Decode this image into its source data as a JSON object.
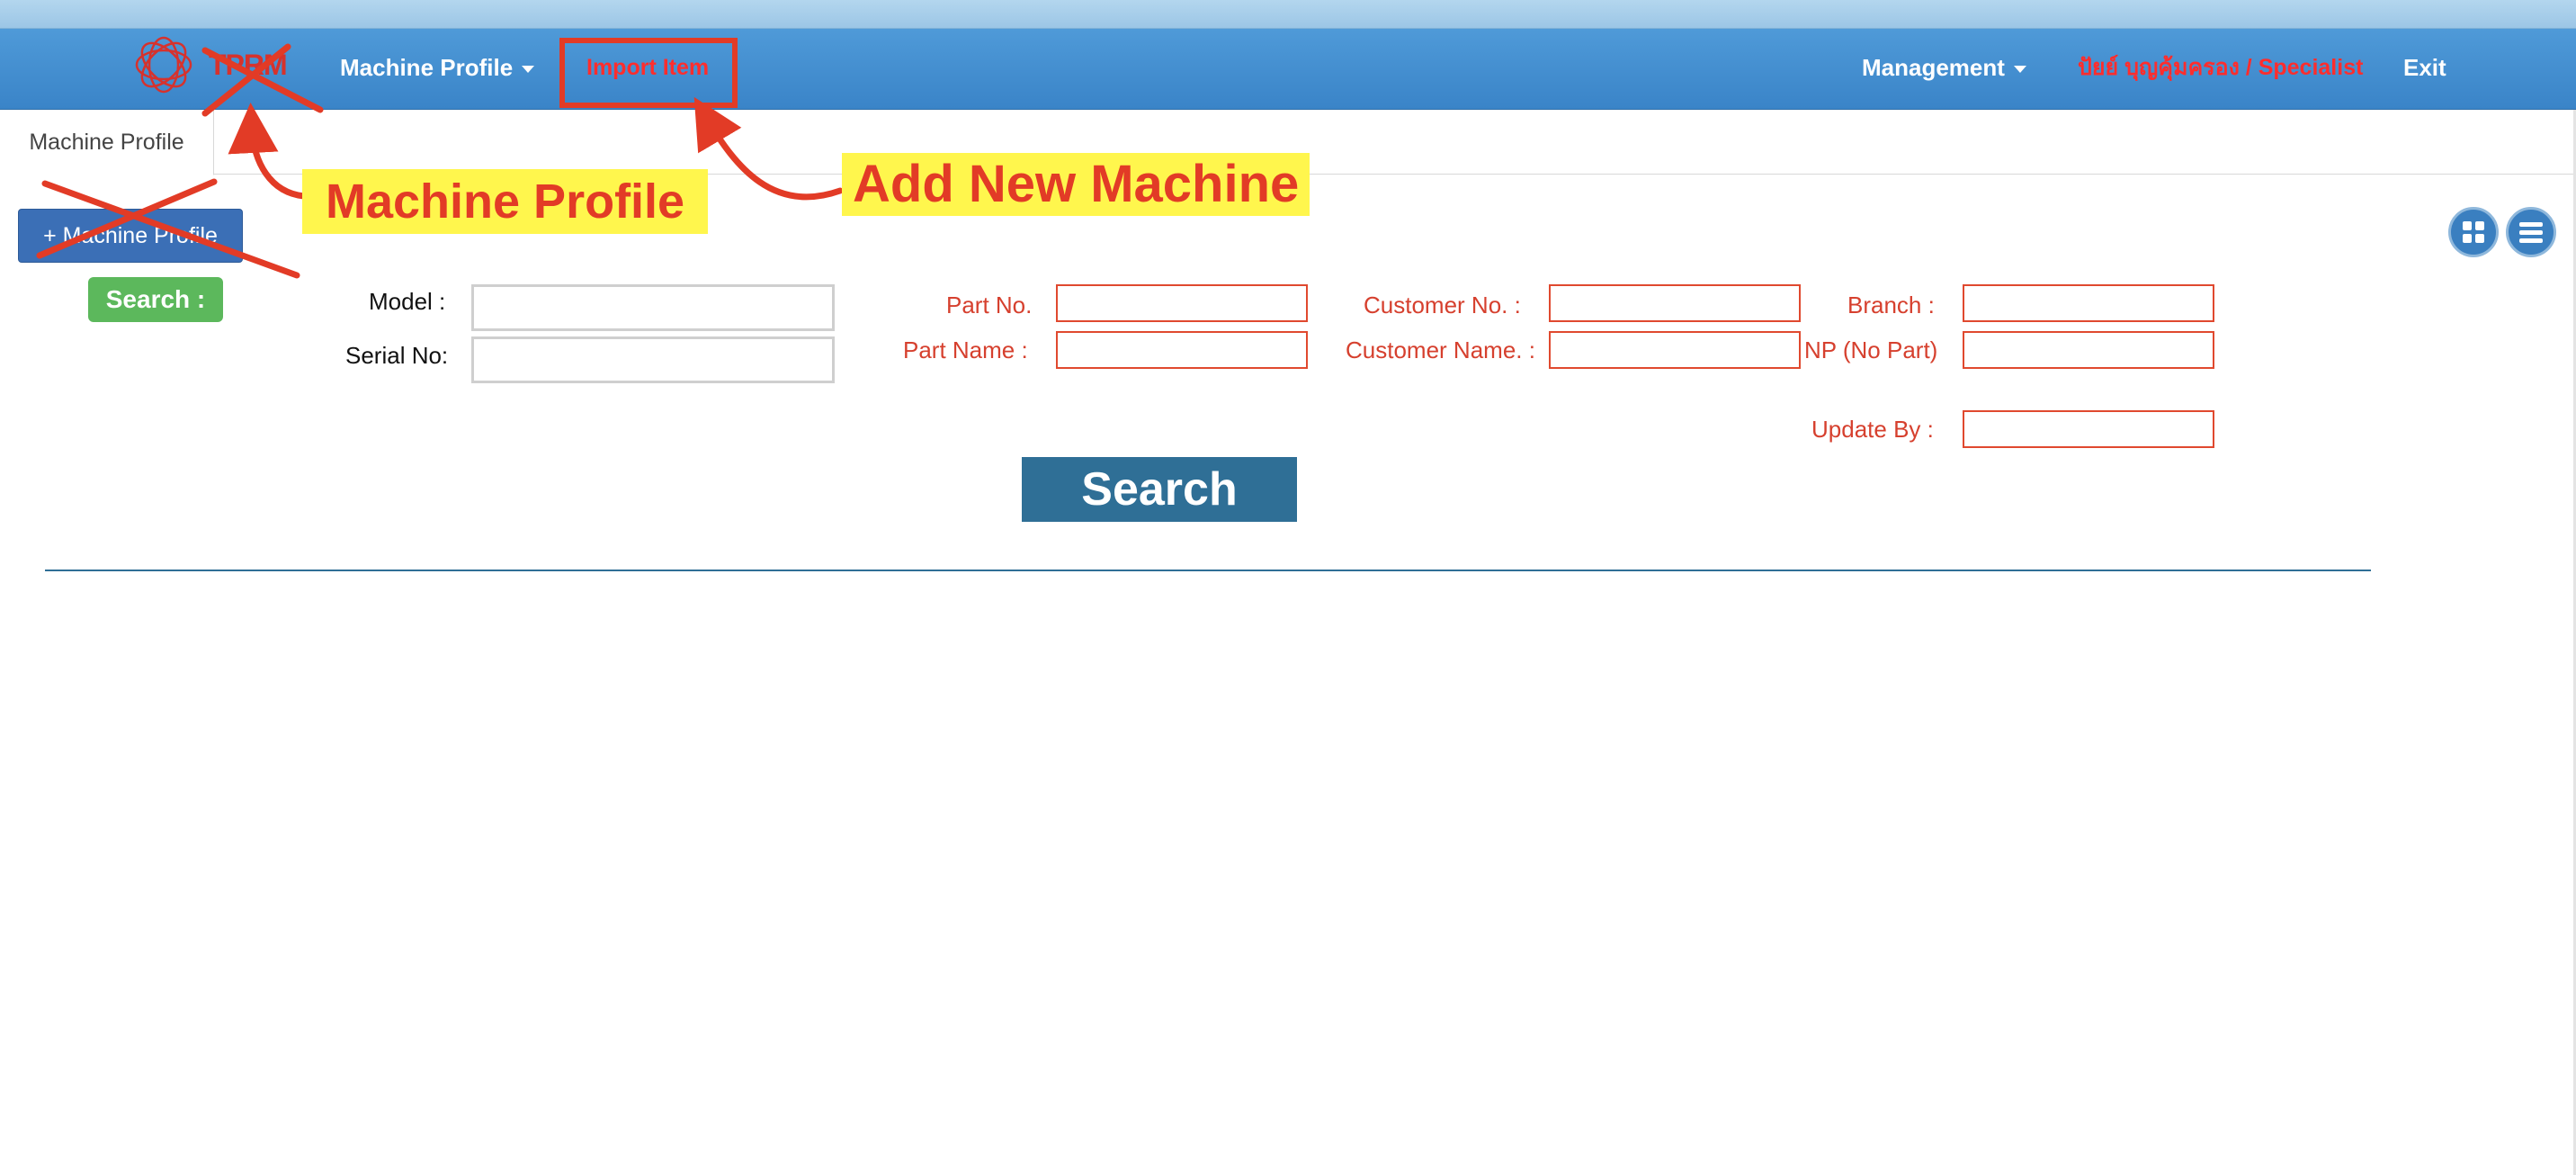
{
  "navbar": {
    "brand": "TPRM",
    "machine_profile_menu": "Machine Profile",
    "import_item": "Import Item",
    "management_menu": "Management",
    "user": "ปัยย์ บุญคุ้มครอง / Specialist",
    "exit": "Exit"
  },
  "tabs": [
    "Machine Profile"
  ],
  "buttons": {
    "add_machine_profile": "+ Machine Profile",
    "search_badge": "Search :",
    "search": "Search"
  },
  "filters": {
    "model_label": "Model :",
    "serial_label": "Serial No:",
    "part_no_label": "Part No.",
    "part_name_label": "Part Name :",
    "customer_no_label": "Customer No. :",
    "customer_name_label": "Customer Name. :",
    "branch_label": "Branch :",
    "np_label": "NP (No Part)",
    "update_by_label": "Update By :",
    "values": {
      "model": "",
      "serial": "",
      "part_no": "",
      "part_name": "",
      "customer_no": "",
      "customer_name": "",
      "branch": "",
      "np": "",
      "update_by": ""
    }
  },
  "annotations": {
    "machine_profile": "Machine Profile",
    "add_new_machine": "Add New Machine"
  },
  "colors": {
    "navbar": "#3f8bcf",
    "annotation_red": "#e23b26",
    "annotation_yellow": "#fff64d",
    "field_red": "#d6402e",
    "search_button": "#2f6f96",
    "badge_green": "#5cb85c"
  },
  "icons": {
    "logo": "swirl-logo-icon",
    "grid_view": "grid-icon",
    "list_view": "list-icon"
  }
}
